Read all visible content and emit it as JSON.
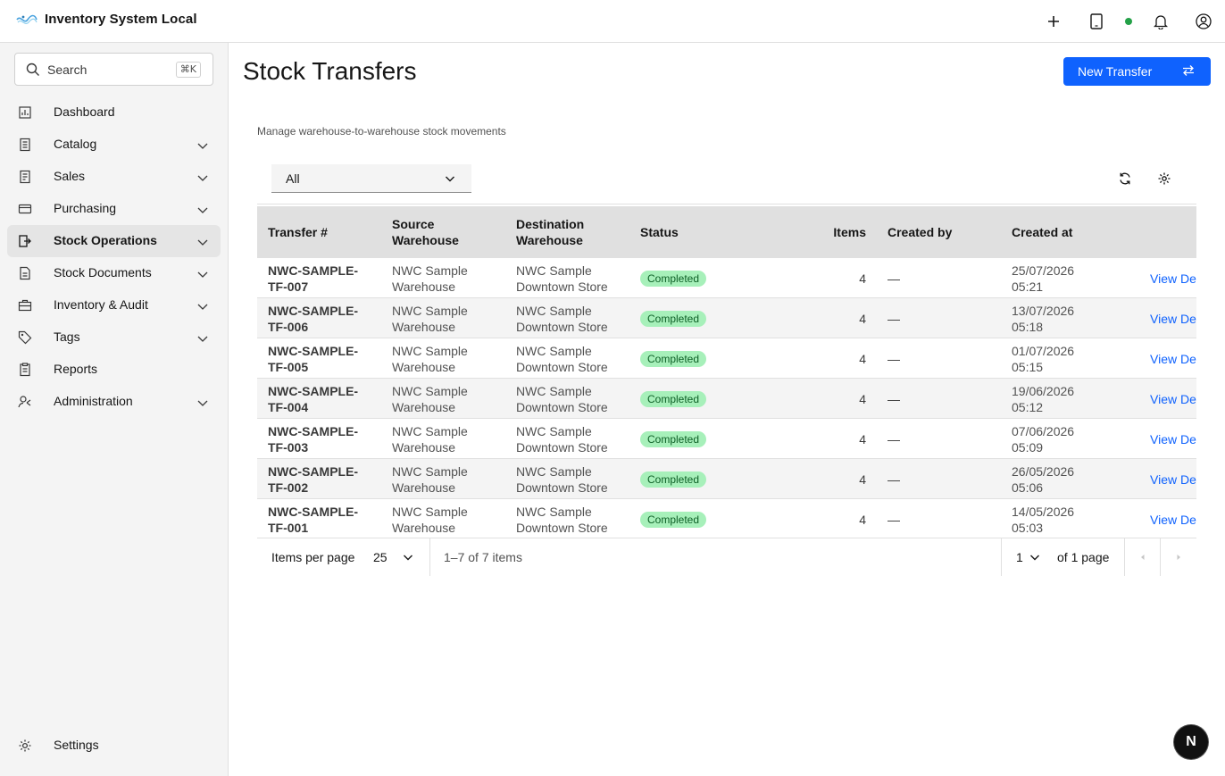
{
  "app": {
    "title": "Inventory System Local"
  },
  "header": {
    "icons": [
      "add-icon",
      "tablet-icon",
      "status-dot",
      "notification-icon",
      "user-avatar-icon"
    ],
    "status_color": "#24a148"
  },
  "sidebar": {
    "search": {
      "placeholder": "Search",
      "shortcut": "⌘K"
    },
    "items": [
      {
        "label": "Dashboard",
        "icon": "dashboard-icon",
        "expandable": false
      },
      {
        "label": "Catalog",
        "icon": "catalog-icon",
        "expandable": true
      },
      {
        "label": "Sales",
        "icon": "sales-icon",
        "expandable": true
      },
      {
        "label": "Purchasing",
        "icon": "purchasing-icon",
        "expandable": true
      },
      {
        "label": "Stock Operations",
        "icon": "stock-operations-icon",
        "expandable": true,
        "active": true
      },
      {
        "label": "Stock Documents",
        "icon": "stock-documents-icon",
        "expandable": true
      },
      {
        "label": "Inventory & Audit",
        "icon": "inventory-audit-icon",
        "expandable": true
      },
      {
        "label": "Tags",
        "icon": "tag-icon",
        "expandable": true
      },
      {
        "label": "Reports",
        "icon": "reports-icon",
        "expandable": false
      },
      {
        "label": "Administration",
        "icon": "administration-icon",
        "expandable": true
      }
    ],
    "settings_label": "Settings"
  },
  "page": {
    "title": "Stock Transfers",
    "primary_button": "New Transfer",
    "subtitle": "Manage warehouse-to-warehouse stock movements",
    "filter": {
      "value": "All"
    },
    "accent_color": "#0f62fe"
  },
  "table": {
    "columns": [
      {
        "label": "Transfer #"
      },
      {
        "label": "Source Warehouse"
      },
      {
        "label": "Destination Warehouse"
      },
      {
        "label": "Status"
      },
      {
        "label": "Items"
      },
      {
        "label": "Created by"
      },
      {
        "label": "Created at"
      }
    ],
    "rows": [
      {
        "id": [
          "NWC-SAMPLE-",
          "TF-007"
        ],
        "source": [
          "NWC Sample",
          "Warehouse"
        ],
        "dest": [
          "NWC Sample",
          "Downtown Store"
        ],
        "status": "Completed",
        "items": "4",
        "created_by": "—",
        "created_at": [
          "25/07/2026",
          "05:21"
        ],
        "action": "View De"
      },
      {
        "id": [
          "NWC-SAMPLE-",
          "TF-006"
        ],
        "source": [
          "NWC Sample",
          "Warehouse"
        ],
        "dest": [
          "NWC Sample",
          "Downtown Store"
        ],
        "status": "Completed",
        "items": "4",
        "created_by": "—",
        "created_at": [
          "13/07/2026",
          "05:18"
        ],
        "action": "View De"
      },
      {
        "id": [
          "NWC-SAMPLE-",
          "TF-005"
        ],
        "source": [
          "NWC Sample",
          "Warehouse"
        ],
        "dest": [
          "NWC Sample",
          "Downtown Store"
        ],
        "status": "Completed",
        "items": "4",
        "created_by": "—",
        "created_at": [
          "01/07/2026",
          "05:15"
        ],
        "action": "View De"
      },
      {
        "id": [
          "NWC-SAMPLE-",
          "TF-004"
        ],
        "source": [
          "NWC Sample",
          "Warehouse"
        ],
        "dest": [
          "NWC Sample",
          "Downtown Store"
        ],
        "status": "Completed",
        "items": "4",
        "created_by": "—",
        "created_at": [
          "19/06/2026",
          "05:12"
        ],
        "action": "View De"
      },
      {
        "id": [
          "NWC-SAMPLE-",
          "TF-003"
        ],
        "source": [
          "NWC Sample",
          "Warehouse"
        ],
        "dest": [
          "NWC Sample",
          "Downtown Store"
        ],
        "status": "Completed",
        "items": "4",
        "created_by": "—",
        "created_at": [
          "07/06/2026",
          "05:09"
        ],
        "action": "View De"
      },
      {
        "id": [
          "NWC-SAMPLE-",
          "TF-002"
        ],
        "source": [
          "NWC Sample",
          "Warehouse"
        ],
        "dest": [
          "NWC Sample",
          "Downtown Store"
        ],
        "status": "Completed",
        "items": "4",
        "created_by": "—",
        "created_at": [
          "26/05/2026",
          "05:06"
        ],
        "action": "View De"
      },
      {
        "id": [
          "NWC-SAMPLE-",
          "TF-001"
        ],
        "source": [
          "NWC Sample",
          "Warehouse"
        ],
        "dest": [
          "NWC Sample",
          "Downtown Store"
        ],
        "status": "Completed",
        "items": "4",
        "created_by": "—",
        "created_at": [
          "14/05/2026",
          "05:03"
        ],
        "action": "View De"
      }
    ]
  },
  "pagination": {
    "items_per_page_label": "Items per page",
    "items_per_page": "25",
    "range": "1–7 of 7 items",
    "page": "1",
    "of_pages": "of 1 page"
  },
  "badge": {
    "letter": "N"
  }
}
